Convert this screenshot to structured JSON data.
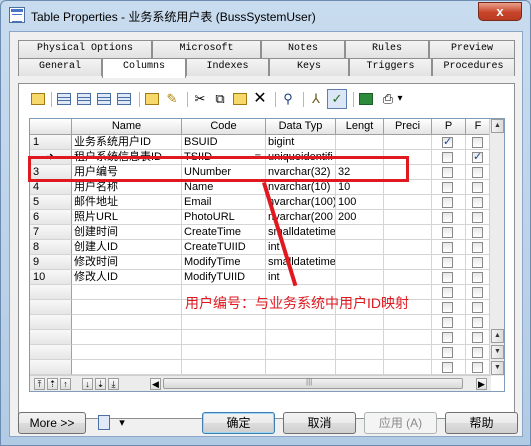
{
  "window": {
    "title": "Table Properties - 业务系统用户表 (BussSystemUser)",
    "close_glyph": "x"
  },
  "tabs_top": [
    {
      "label": "Physical Options"
    },
    {
      "label": "Microsoft"
    },
    {
      "label": "Notes"
    },
    {
      "label": "Rules"
    },
    {
      "label": "Preview"
    }
  ],
  "tabs_bottom": [
    {
      "label": "General"
    },
    {
      "label": "Columns",
      "active": true
    },
    {
      "label": "Indexes"
    },
    {
      "label": "Keys"
    },
    {
      "label": "Triggers"
    },
    {
      "label": "Procedures"
    }
  ],
  "toolbar": {
    "icons": [
      "properties-icon",
      "add-row-icon",
      "insert-row-icon",
      "add-columns-icon",
      "domain-icon",
      "new-icon",
      "edit-icon",
      "cut-icon",
      "copy-icon",
      "paste-icon",
      "delete-icon",
      "find-icon",
      "filter-icon",
      "customize-columns-icon",
      "excel-icon",
      "print-icon"
    ],
    "dropdown_glyph": "▾"
  },
  "grid": {
    "headers": {
      "name": "Name",
      "code": "Code",
      "data_type": "Data Typ",
      "length": "Lengt",
      "precision": "Preci",
      "p": "P",
      "f": "F"
    },
    "current_row_marker": "➜",
    "rows": [
      {
        "num": "1",
        "name": "业务系统用户ID",
        "code": "BSUID",
        "data_type": "bigint",
        "length": "",
        "p": true,
        "f": false
      },
      {
        "num": "",
        "name": "租户系统信息表ID",
        "code": "TSIID",
        "eq": "=",
        "data_type": "uniqueidentifi",
        "length": "",
        "p": false,
        "f": true
      },
      {
        "num": "3",
        "name": "用户编号",
        "code": "UNumber",
        "data_type": "nvarchar(32)",
        "length": "32",
        "p": false,
        "f": false
      },
      {
        "num": "4",
        "name": "用户名称",
        "code": "Name",
        "data_type": "nvarchar(10)",
        "length": "10",
        "p": false,
        "f": false
      },
      {
        "num": "5",
        "name": "邮件地址",
        "code": "Email",
        "data_type": "nvarchar(100)",
        "length": "100",
        "p": false,
        "f": false
      },
      {
        "num": "6",
        "name": "照片URL",
        "code": "PhotoURL",
        "data_type": "nvarchar(200",
        "length": "200",
        "p": false,
        "f": false
      },
      {
        "num": "7",
        "name": "创建时间",
        "code": "CreateTime",
        "data_type": "smalldatetime",
        "length": "",
        "p": false,
        "f": false
      },
      {
        "num": "8",
        "name": "创建人ID",
        "code": "CreateTUIID",
        "data_type": "int",
        "length": "",
        "p": false,
        "f": false
      },
      {
        "num": "9",
        "name": "修改时间",
        "code": "ModifyTime",
        "data_type": "smalldatetime",
        "length": "",
        "p": false,
        "f": false
      },
      {
        "num": "10",
        "name": "修改人ID",
        "code": "ModifyTUIID",
        "data_type": "int",
        "length": "",
        "p": false,
        "f": false
      }
    ],
    "scroll_up_glyph": "▲",
    "scroll_down_glyph": "▼",
    "scroll_left_glyph": "◀",
    "scroll_right_glyph": "▶",
    "nav_glyphs": [
      "⤒",
      "⇡",
      "↑",
      "↓",
      "⇣",
      "⤓"
    ]
  },
  "annotation": {
    "text": "用户编号：与业务系统中用户ID映射",
    "color": "#e0181f"
  },
  "footer": {
    "more": "More >>",
    "ok": "确定",
    "cancel": "取消",
    "apply": "应用 (A)",
    "help": "帮助",
    "dropdown_glyph": "▾"
  }
}
